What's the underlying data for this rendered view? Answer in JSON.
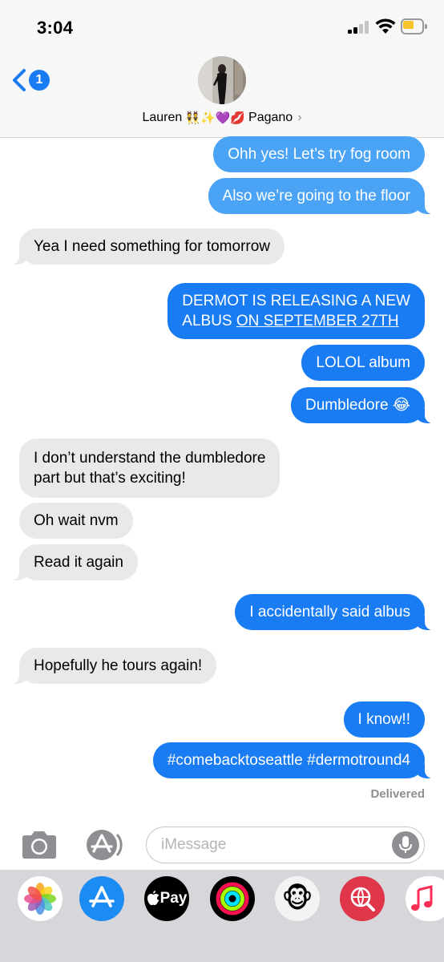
{
  "status_bar": {
    "time": "3:04"
  },
  "header": {
    "back_badge": "1",
    "contact_first": "Lauren",
    "contact_emojis": "👯✨💜💋",
    "contact_last": "Pagano",
    "chevron": "›"
  },
  "messages": [
    {
      "from": "me",
      "text": "Ohh yes! Let’s try fog room"
    },
    {
      "from": "me",
      "text": "Also we’re going to the floor"
    },
    {
      "from": "them",
      "text": "Yea I need something for tomorrow"
    },
    {
      "from": "me",
      "line1": "DERMOT IS RELEASING A NEW",
      "line2a": "ALBUS ",
      "line2b": "ON SEPTEMBER 27TH"
    },
    {
      "from": "me",
      "text": "LOLOL album"
    },
    {
      "from": "me",
      "text": "Dumbledore 😂"
    },
    {
      "from": "them",
      "line1": "I don’t understand the dumbledore",
      "line2": "part but that’s exciting!"
    },
    {
      "from": "them",
      "text": "Oh wait nvm"
    },
    {
      "from": "them",
      "text": "Read it again"
    },
    {
      "from": "me",
      "text": "I accidentally said albus"
    },
    {
      "from": "them",
      "text": "Hopefully he tours again!"
    },
    {
      "from": "me",
      "text": "I know!!"
    },
    {
      "from": "me",
      "text": "#comebacktoseattle #dermotround4"
    }
  ],
  "delivered": "Delivered",
  "input": {
    "placeholder": "iMessage"
  },
  "apps": {
    "apple_pay_label": "Pay",
    "memoji": "🐵"
  },
  "colors": {
    "sent_bubble": "#1a7cf2",
    "sent_bubble_faded": "#4aa3f4",
    "received_bubble": "#e9e9eb",
    "badge": "#1a7cf2"
  }
}
